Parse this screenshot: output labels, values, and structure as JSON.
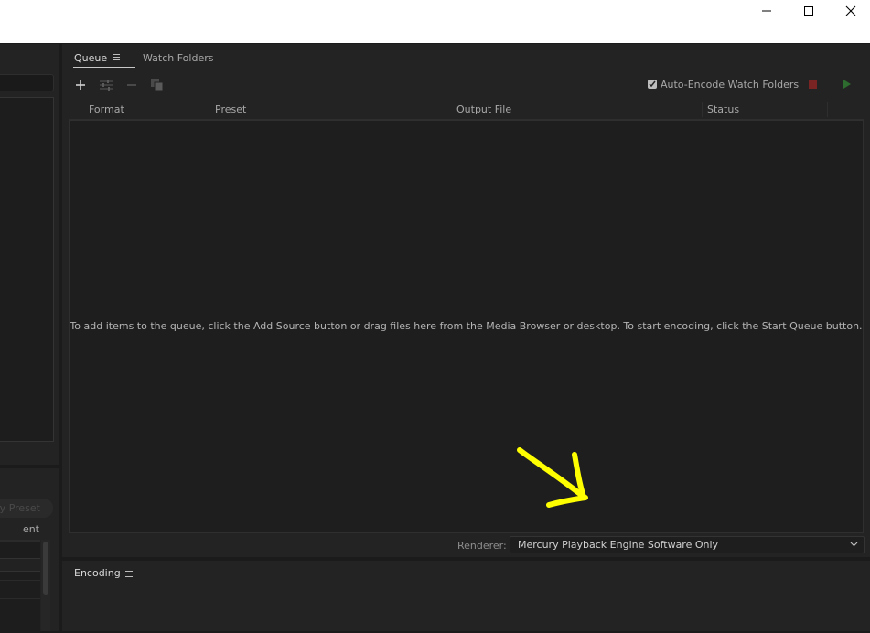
{
  "window": {
    "controls": [
      {
        "name": "minimize-icon"
      },
      {
        "name": "maximize-icon"
      },
      {
        "name": "close-icon"
      }
    ]
  },
  "left_panel": {
    "preset_button_label": "ly Preset",
    "label": "ent"
  },
  "queue_panel": {
    "tabs": [
      {
        "label": "Queue",
        "active": true
      },
      {
        "label": "Watch Folders",
        "active": false
      }
    ],
    "toolbar": {
      "icons": [
        "add-icon",
        "settings-sliders-icon",
        "remove-icon",
        "duplicate-icon"
      ],
      "auto_encode_label": "Auto-Encode Watch Folders",
      "auto_encode_checked": true
    },
    "columns": [
      "Format",
      "Preset",
      "Output File",
      "Status"
    ],
    "empty_hint": "To add items to the queue, click the Add Source button or drag files here from the Media Browser or desktop.  To start encoding, click the Start Queue button.",
    "renderer": {
      "label": "Renderer:",
      "value": "Mercury Playback Engine Software Only"
    }
  },
  "encoding_panel": {
    "tab_label": "Encoding"
  },
  "colors": {
    "panel_bg": "#232323",
    "list_bg": "#1e1e1e",
    "stop_red": "#7a2424",
    "play_green": "#2e6b2e",
    "annotation_yellow": "#ffff00"
  }
}
